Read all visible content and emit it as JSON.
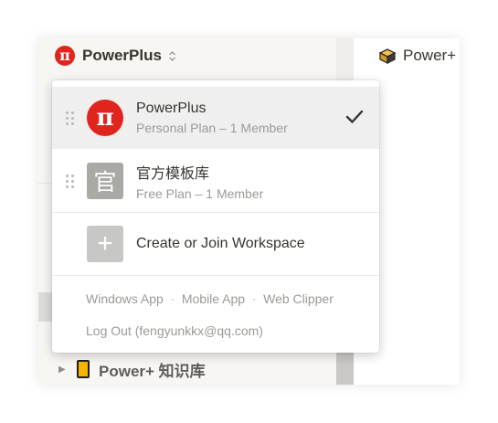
{
  "sidebar": {
    "workspace_name": "PowerPlus",
    "tree_item_label": "Power+ 知识库"
  },
  "main": {
    "page_title": "Power+"
  },
  "dropdown": {
    "workspaces": [
      {
        "name": "PowerPlus",
        "plan": "Personal Plan – 1 Member",
        "avatar": "π",
        "selected": true
      },
      {
        "name": "官方模板库",
        "plan": "Free Plan – 1 Member",
        "avatar": "官",
        "selected": false
      }
    ],
    "create_label": "Create or Join Workspace",
    "links": {
      "windows_app": "Windows App",
      "mobile_app": "Mobile App",
      "web_clipper": "Web Clipper",
      "separator": "·"
    },
    "logout_label": "Log Out (fengyunkkx@qq.com)"
  },
  "colors": {
    "brand_red": "#e0241e",
    "sidebar_bg": "#f7f6f3",
    "selected_row_bg": "#efefef",
    "muted_text": "#9b9a97"
  }
}
